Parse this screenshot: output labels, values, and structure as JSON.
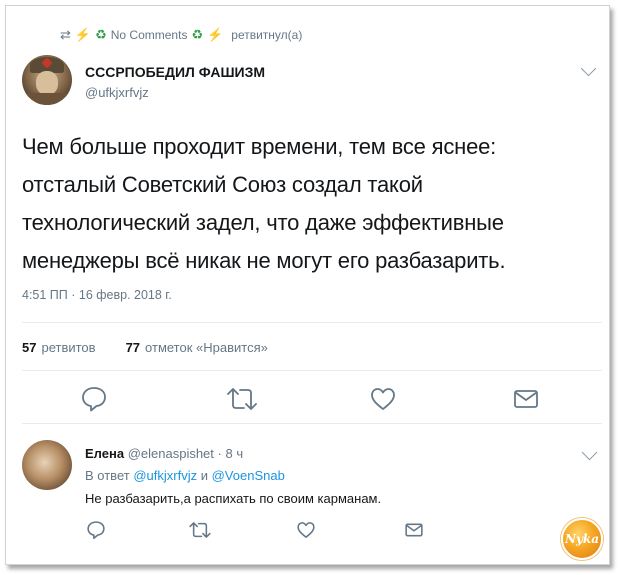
{
  "retweet": {
    "comments_label": "No Comments",
    "label": "ретвитнул(а)"
  },
  "tweet": {
    "display_name": "СССРПОБЕДИЛ ФАШИЗМ",
    "handle": "@ufkjxrfvjz",
    "text_lines": [
      "Чем больше проходит времени, тем все яснее:",
      "отсталый Советский Союз создал такой",
      "технологический задел, что даже эффективные",
      "менеджеры всё никак не могут его разбазарить."
    ],
    "timestamp": "4:51 ПП · 16 февр. 2018 г.",
    "retweets_count": "57",
    "retweets_label": "ретвитов",
    "likes_count": "77",
    "likes_label": "отметок «Нравится»"
  },
  "reply": {
    "display_name": "Елена",
    "handle": "@elenaspishet",
    "separator": "·",
    "time": "8 ч",
    "reply_prefix": "В ответ",
    "mention1": "@ufkjxrfvjz",
    "conj": "и",
    "mention2": "@VoenSnab",
    "text": "Не разбазарить,а распихать по своим карманам."
  },
  "watermark": "Nyka",
  "colors": {
    "text": "#14171a",
    "muted": "#657786",
    "link": "#1b95e0",
    "icon": "#657786",
    "divider": "#e6ecf0"
  },
  "icons": [
    "retweet-icon",
    "bolt-icon",
    "recycle-icon",
    "chevron-down-icon",
    "reply-icon",
    "like-icon",
    "message-icon"
  ]
}
